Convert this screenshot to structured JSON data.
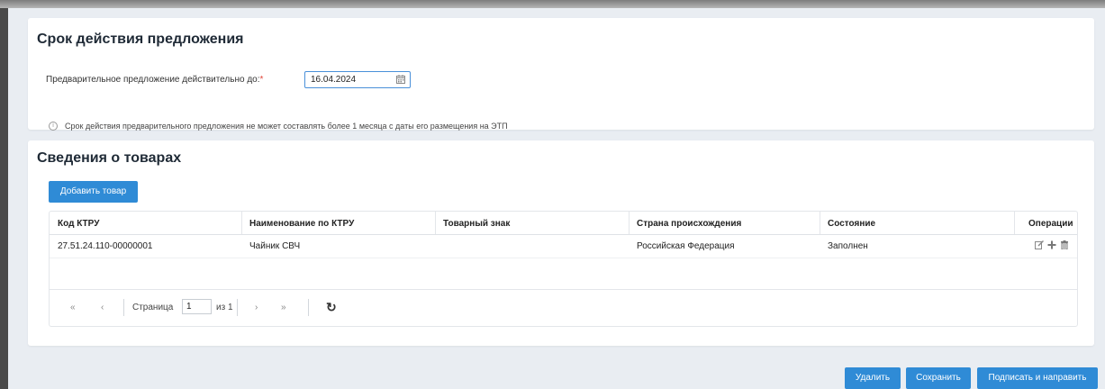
{
  "validity": {
    "title": "Срок действия предложения",
    "field_label": "Предварительное предложение действительно до:",
    "required_mark": "*",
    "date_value": "16.04.2024",
    "hint": "Срок действия предварительного предложения не может составлять более 1 месяца с даты его размещения на ЭТП"
  },
  "goods": {
    "title": "Сведения о товарах",
    "add_button": "Добавить товар",
    "columns": [
      "Код КТРУ",
      "Наименование по КТРУ",
      "Товарный знак",
      "Страна происхождения",
      "Состояние",
      "Операции"
    ],
    "rows": [
      {
        "code": "27.51.24.110-00000001",
        "name": "Чайник СВЧ",
        "trademark": "",
        "country": "Российская Федерация",
        "status": "Заполнен"
      }
    ],
    "pager": {
      "first": "«",
      "prev": "‹",
      "page_label": "Страница",
      "page_value": "1",
      "of_label": "из 1",
      "next": "›",
      "last": "»",
      "refresh": "↻"
    }
  },
  "actions": {
    "delete": "Удалить",
    "save": "Сохранить",
    "sign_send": "Подписать и направить"
  },
  "colors": {
    "primary": "#2f8bd6",
    "background": "#e9edf2"
  }
}
